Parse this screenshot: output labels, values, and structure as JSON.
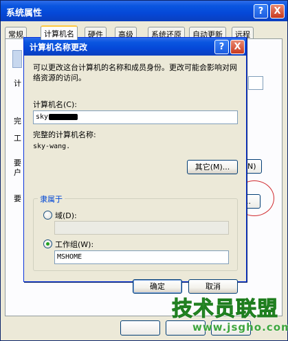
{
  "back_window": {
    "title": "系统属性",
    "help_btn": "?",
    "close_btn": "X",
    "tabs": [
      "常规",
      "计算机名",
      "硬件",
      "高级",
      "系统还原",
      "自动更新",
      "远程"
    ],
    "active_tab": 1,
    "peek_texts": [
      "计",
      "完",
      "工",
      "要",
      "户",
      "要"
    ],
    "peek_button_1": "N)",
    "peek_button_2": ".."
  },
  "dialog": {
    "title": "计算机名称更改",
    "help_btn": "?",
    "close_btn": "X",
    "description": "可以更改这台计算机的名称和成员身份。更改可能会影响对网络资源的访问。",
    "computer_name_label": "计算机名(C):",
    "computer_name_value": "sky",
    "full_name_label": "完整的计算机名称:",
    "full_name_value": "sky-wang.",
    "more_button": "其它(M)...",
    "member_of_label": "隶属于",
    "domain_label": "域(D):",
    "domain_value": "",
    "workgroup_label": "工作组(W):",
    "workgroup_value": "MSHOME",
    "selected_membership": "workgroup",
    "ok_button": "确定",
    "cancel_button": "取消"
  },
  "watermark": {
    "brand": "技术员联盟",
    "url": "www.jsgho.com"
  },
  "colors": {
    "title_blue": "#0A56E0",
    "dialog_bg": "#ECE9D8",
    "group_label": "#0046D5",
    "highlight_oval": "#D0282C",
    "watermark_green": "#3EA63E"
  }
}
